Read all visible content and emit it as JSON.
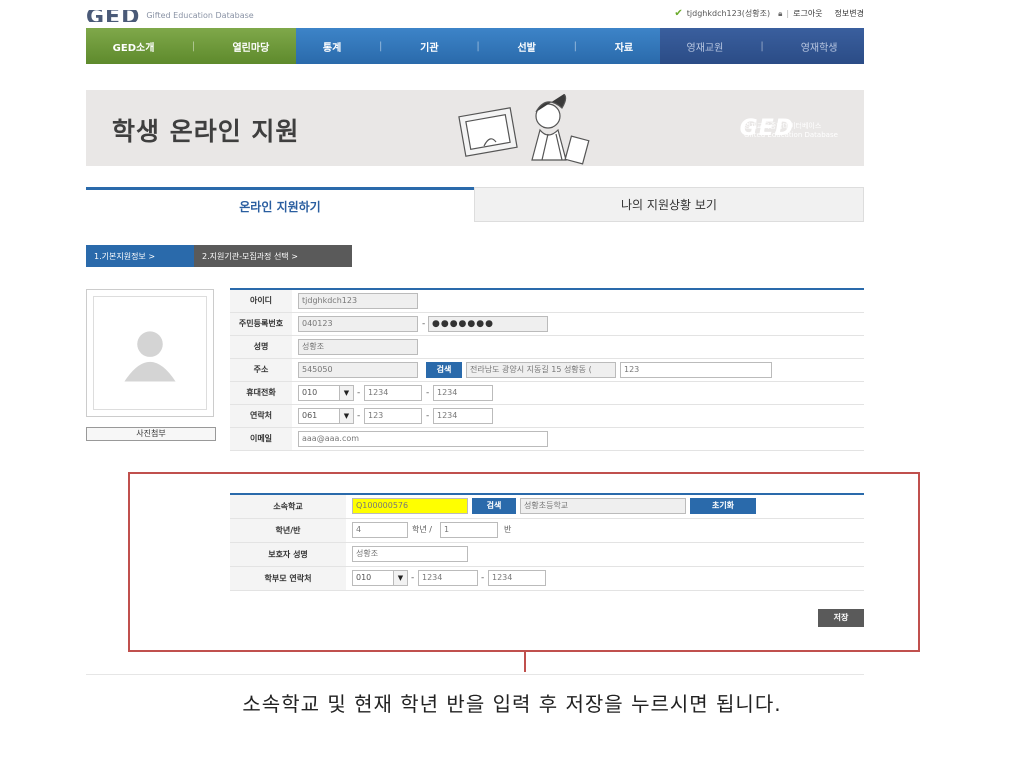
{
  "header": {
    "logo_mark": "GED",
    "logo_sub": "Gifted Education Database",
    "user": "tjdghkdch123(성황조)",
    "logout": "로그아웃",
    "profile": "정보변경",
    "separator": "|"
  },
  "nav": {
    "green": [
      "GED소개",
      "열린마당"
    ],
    "blue": [
      "통계",
      "기관",
      "선발",
      "자료"
    ],
    "dark": [
      "영재교원",
      "영재학생"
    ],
    "separator": "|"
  },
  "banner": {
    "title": "학생 온라인 지원",
    "brand": "GED",
    "brand_sub_ko": "영재교육종합데이터베이스",
    "brand_sub_en": "Gifted Education Database"
  },
  "tabs": [
    {
      "label": "온라인 지원하기",
      "active": true
    },
    {
      "label": "나의 지원상황 보기",
      "active": false
    }
  ],
  "steps": [
    "1.기본지원정보 >",
    "2.지원기관-모집과정 선택 >"
  ],
  "photo": {
    "button": "사진첨부"
  },
  "form": {
    "id_label": "아이디",
    "id_value": "tjdghkdch123",
    "rrn_label": "주민등록번호",
    "rrn_front": "040123",
    "rrn_back": "●●●●●●●",
    "name_label": "성명",
    "name_value": "성황조",
    "addr_label": "주소",
    "zip": "545050",
    "search": "검색",
    "addr1": "전라남도 광양시 지동길 15 성황동 (",
    "addr2": "123",
    "mobile_label": "휴대전화",
    "mobile": [
      "010",
      "1234",
      "1234"
    ],
    "phone_label": "연락처",
    "phone": [
      "061",
      "123",
      "1234"
    ],
    "email_label": "이메일",
    "email": "aaa@aaa.com",
    "dash": "-",
    "arrow": "▼"
  },
  "form2": {
    "school_label": "소속학교",
    "school_code": "Q100000576",
    "search": "검색",
    "school_name": "성황초등학교",
    "reset": "초기화",
    "grade_label": "학년/반",
    "grade": "4",
    "grade_unit": "학년 /",
    "class": "1",
    "class_unit": "반",
    "guardian_label": "보호자 성명",
    "guardian": "성황조",
    "parent_phone_label": "학부모 연락처",
    "parent_phone": [
      "010",
      "1234",
      "1234"
    ],
    "dash": "-",
    "arrow": "▼",
    "save": "저장"
  },
  "caption": "소속학교 및 현재 학년 반을 입력 후 저장을 누르시면 됩니다.",
  "colors": {
    "accent_blue": "#2a6aab",
    "nav_green": "#6a9a3a",
    "highlight_red": "#c0504d",
    "yellow": "#ffff00"
  }
}
